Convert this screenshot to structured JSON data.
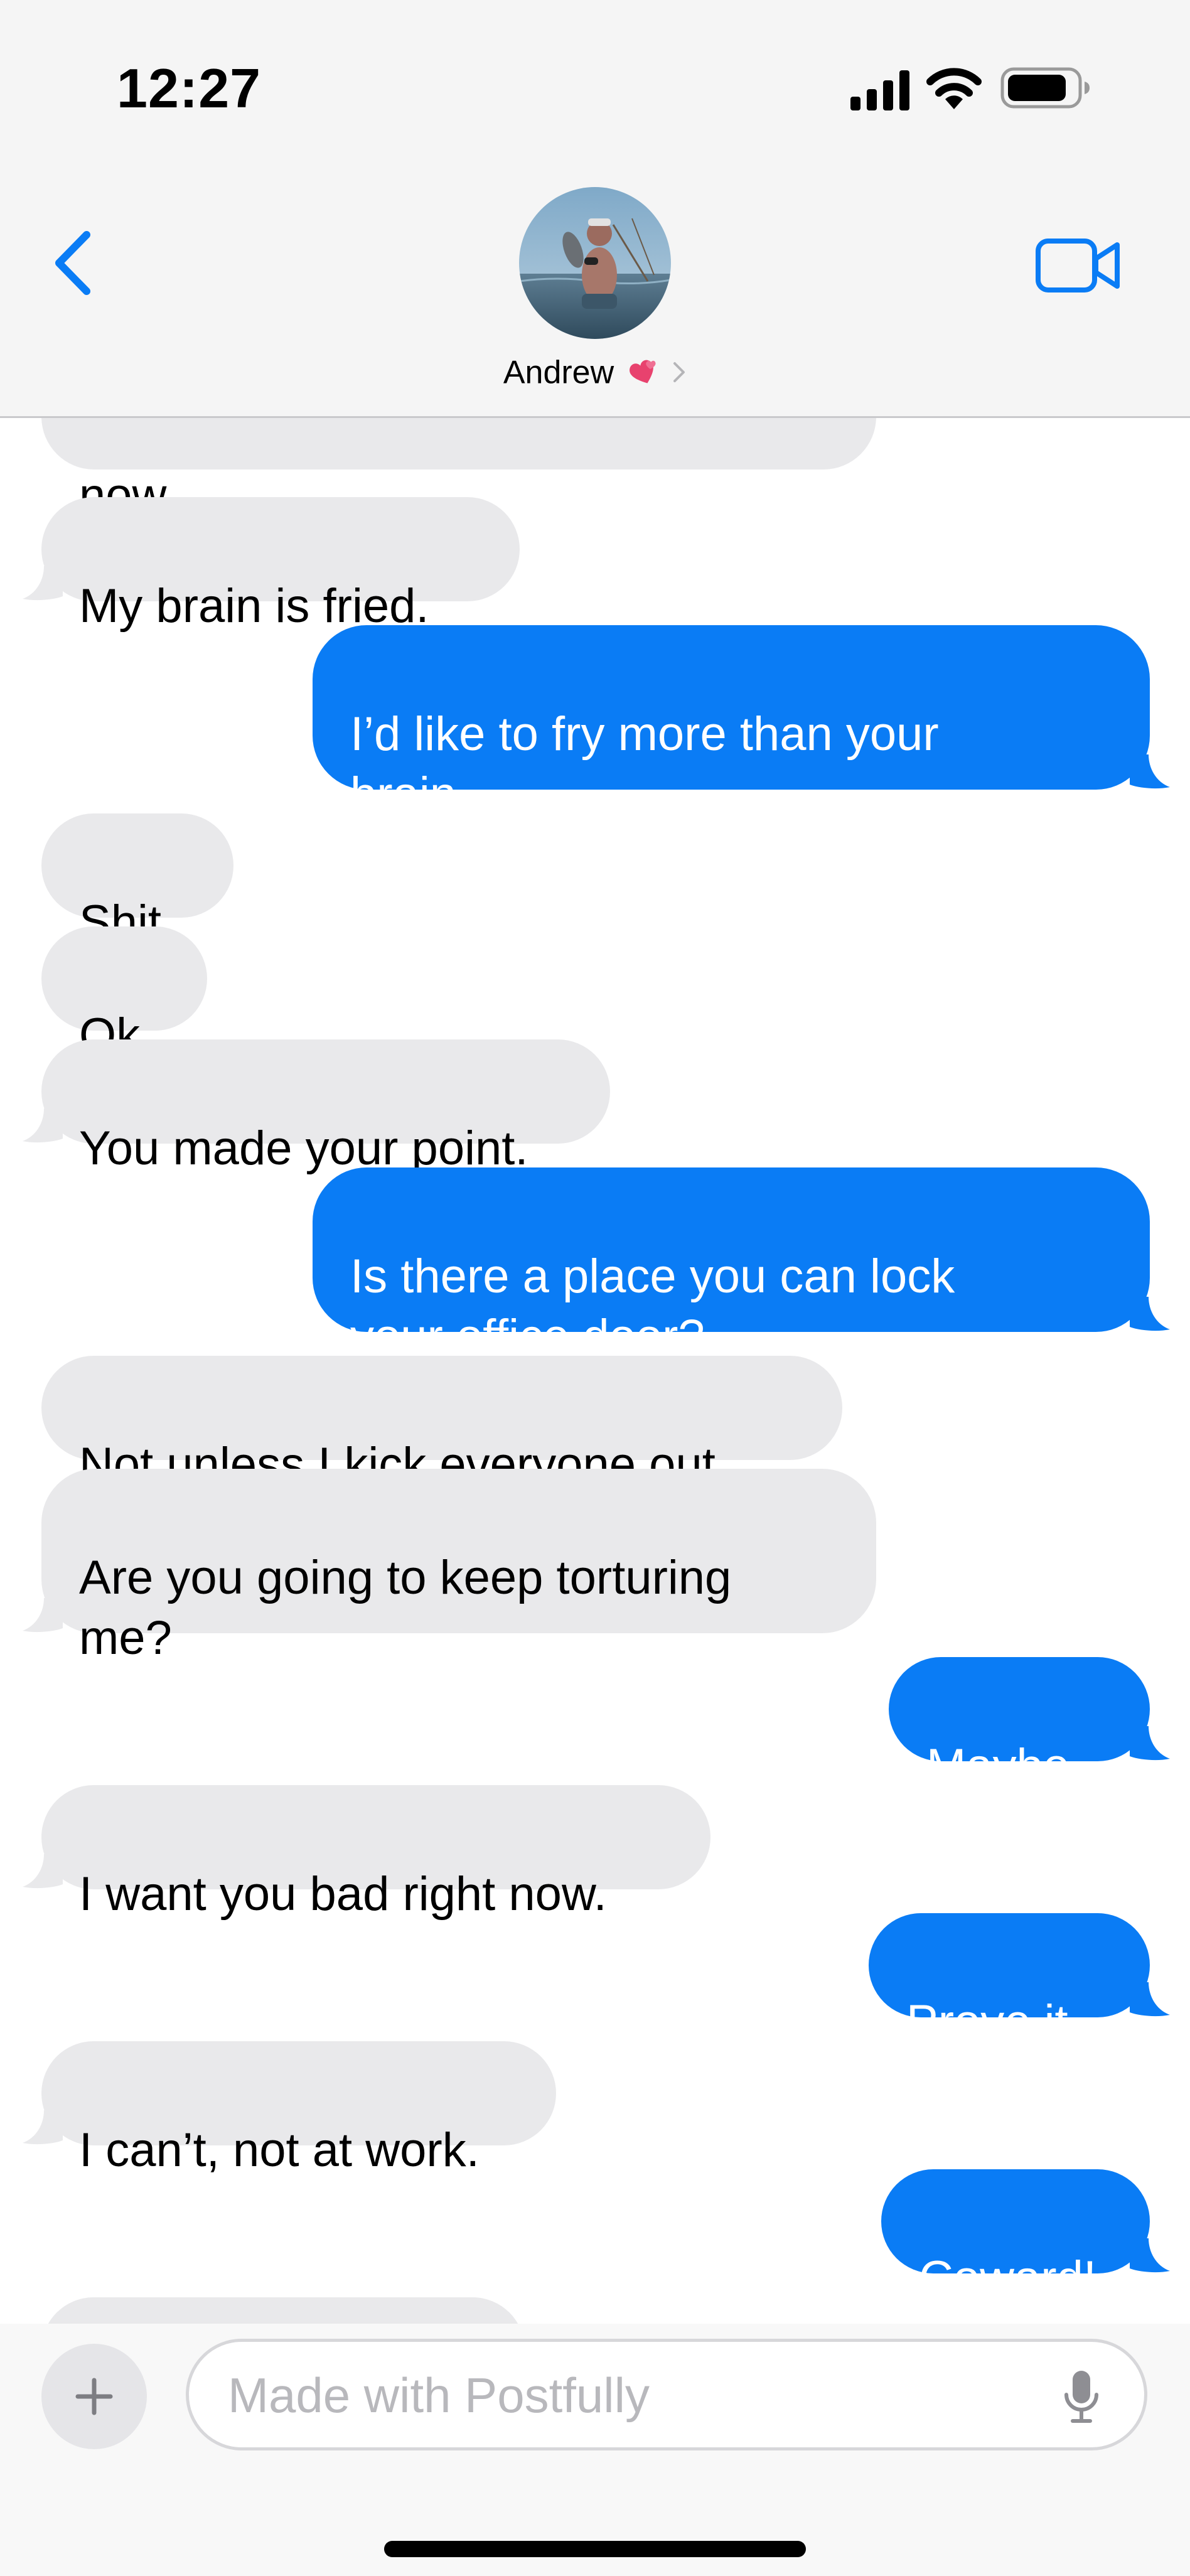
{
  "status_bar": {
    "time": "12:27"
  },
  "header": {
    "contact_name": "Andrew",
    "name_emoji": "heart-icon",
    "back_icon": "chevron-left-icon",
    "video_icon": "video-camera-icon"
  },
  "colors": {
    "sent_bubble": "#0a7cf5",
    "received_bubble": "#e9e9eb",
    "accent": "#0a7cf5",
    "header_bg": "#f5f5f5"
  },
  "messages": [
    {
      "from": "them",
      "text": "now."
    },
    {
      "from": "them",
      "text": "My brain is fried."
    },
    {
      "from": "me",
      "text": "I’d like to fry more than your\nbrain."
    },
    {
      "from": "them",
      "text": "Shit."
    },
    {
      "from": "them",
      "text": "Ok."
    },
    {
      "from": "them",
      "text": "You made your point."
    },
    {
      "from": "me",
      "text": "Is there a place you can lock\nyour office door?"
    },
    {
      "from": "them",
      "text": "Not unless I kick everyone out."
    },
    {
      "from": "them",
      "text": "Are you going to keep torturing\nme?"
    },
    {
      "from": "me",
      "text": "Maybe."
    },
    {
      "from": "them",
      "text": "I want you bad right now."
    },
    {
      "from": "me",
      "text": "Prove it."
    },
    {
      "from": "them",
      "text": "I can’t, not at work."
    },
    {
      "from": "me",
      "text": "Coward!"
    },
    {
      "from": "them",
      "text": ""
    }
  ],
  "composer": {
    "placeholder": "Made with Postfully",
    "plus_icon": "plus-icon",
    "mic_icon": "microphone-icon"
  }
}
